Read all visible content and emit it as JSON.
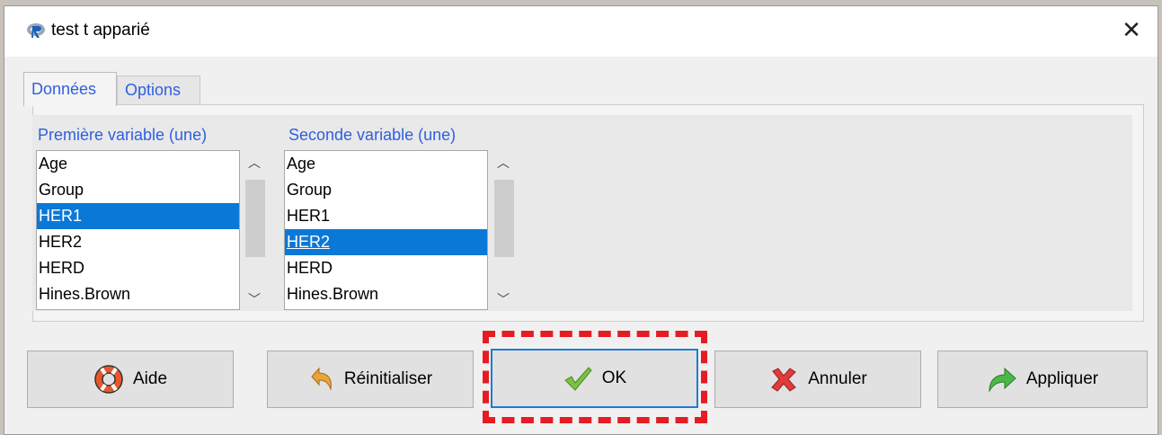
{
  "window": {
    "title": "test t apparié",
    "close_glyph": "✕"
  },
  "tabs": [
    {
      "label": "Données",
      "active": true
    },
    {
      "label": "Options",
      "active": false
    }
  ],
  "lists": {
    "first": {
      "label": "Première variable (une)",
      "items": [
        "Age",
        "Group",
        "HER1",
        "HER2",
        "HERD",
        "Hines.Brown"
      ],
      "selected": "HER1"
    },
    "second": {
      "label": "Seconde variable (une)",
      "items": [
        "Age",
        "Group",
        "HER1",
        "HER2",
        "HERD",
        "Hines.Brown"
      ],
      "selected": "HER2"
    }
  },
  "scroll_glyphs": {
    "up": "︿",
    "down": "﹀"
  },
  "buttons": {
    "help": {
      "label": "Aide",
      "icon": "lifebuoy-icon"
    },
    "reset": {
      "label": "Réinitialiser",
      "icon": "undo-arrow-icon"
    },
    "ok": {
      "label": "OK",
      "icon": "checkmark-icon"
    },
    "cancel": {
      "label": "Annuler",
      "icon": "red-x-icon"
    },
    "apply": {
      "label": "Appliquer",
      "icon": "green-arrow-icon"
    }
  },
  "colors": {
    "accent": "#2f5fe0",
    "selection": "#0a78d7",
    "highlight_box": "#e51c23"
  }
}
